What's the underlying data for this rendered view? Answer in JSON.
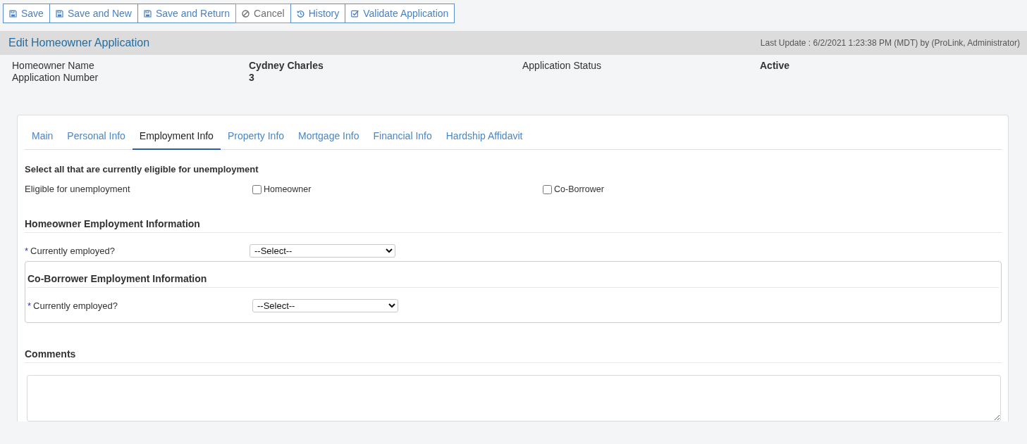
{
  "toolbar": {
    "buttons": [
      {
        "label": "Save",
        "kind": "save"
      },
      {
        "label": "Save and New",
        "kind": "save"
      },
      {
        "label": "Save and Return",
        "kind": "save"
      },
      {
        "label": "Cancel",
        "kind": "cancel"
      },
      {
        "label": "History",
        "kind": "history"
      },
      {
        "label": "Validate Application",
        "kind": "validate"
      }
    ]
  },
  "header": {
    "title": "Edit Homeowner Application",
    "last_update": "Last Update : 6/2/2021 1:23:38 PM (MDT) by (ProLink, Administrator)"
  },
  "summary": {
    "rows": [
      [
        {
          "label": "Homeowner Name",
          "value": "Cydney Charles"
        },
        {
          "label": "Application Status",
          "value": "Active"
        }
      ],
      [
        {
          "label": "Application Number",
          "value": "3"
        }
      ]
    ]
  },
  "tabs": [
    {
      "label": "Main",
      "selected": false
    },
    {
      "label": "Personal Info",
      "selected": false
    },
    {
      "label": "Employment Info",
      "selected": true
    },
    {
      "label": "Property Info",
      "selected": false
    },
    {
      "label": "Mortgage Info",
      "selected": false
    },
    {
      "label": "Financial Info",
      "selected": false
    },
    {
      "label": "Hardship Affidavit",
      "selected": false
    }
  ],
  "eligibility": {
    "heading": "Select all that are currently eligible for unemployment",
    "label": "Eligible for unemployment",
    "options": [
      {
        "label": "Homeowner",
        "checked": false
      },
      {
        "label": "Co-Borrower",
        "checked": false
      }
    ]
  },
  "sections": [
    {
      "kind": "plain",
      "heading": "Homeowner Employment Information",
      "fields": [
        {
          "required_mark": "*",
          "label": "Currently employed?",
          "value": "--Select--"
        }
      ]
    },
    {
      "kind": "boxed",
      "heading": "Co-Borrower Employment Information",
      "fields": [
        {
          "required_mark": "*",
          "label": "Currently employed?",
          "value": "--Select--"
        }
      ]
    }
  ],
  "comments": {
    "heading": "Comments"
  }
}
